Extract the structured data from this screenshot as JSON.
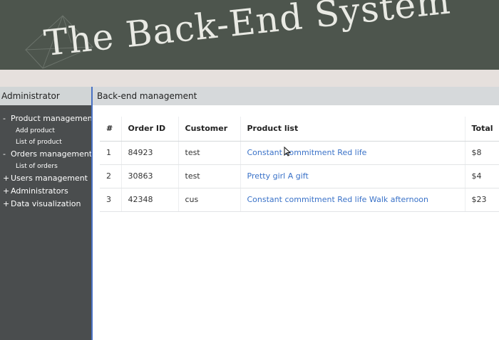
{
  "banner": {
    "title": "The Back-End System"
  },
  "sidebar": {
    "header": "Administrator",
    "menu": [
      {
        "sign": "-",
        "label": "Product management",
        "children": [
          "Add product",
          "List of product"
        ]
      },
      {
        "sign": "-",
        "label": "Orders management",
        "children": [
          "List of orders"
        ]
      },
      {
        "sign": "+",
        "label": "Users management"
      },
      {
        "sign": "+",
        "label": "Administrators"
      },
      {
        "sign": "+",
        "label": "Data visualization"
      }
    ]
  },
  "main": {
    "header": "Back-end management",
    "table": {
      "columns": [
        "#",
        "Order ID",
        "Customer",
        "Product list",
        "Total"
      ],
      "rows": [
        [
          "1",
          "84923",
          "test",
          "Constant commitment Red life",
          "$8"
        ],
        [
          "2",
          "30863",
          "test",
          "Pretty girl A gift",
          "$4"
        ],
        [
          "3",
          "42348",
          "cus",
          "Constant commitment Red life Walk afternoon",
          "$23"
        ]
      ]
    }
  },
  "colors": {
    "banner_bg": "#4d554d",
    "sidebar_bg": "#4a4d4e",
    "link": "#3a72c8",
    "accent_border": "#4a72c4"
  }
}
